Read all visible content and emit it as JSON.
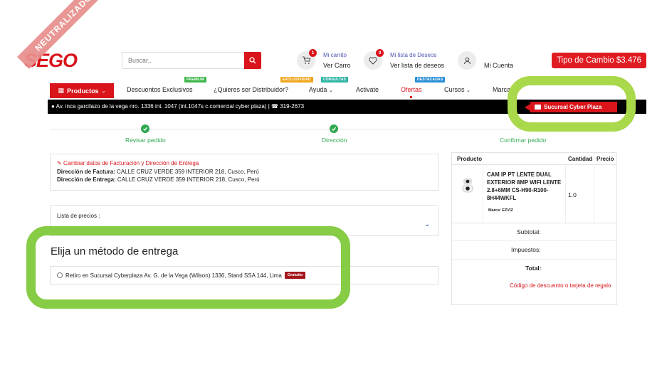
{
  "header": {
    "logo": "SEGO",
    "search_placeholder": "Buscar..",
    "cart_small": "Mi carrito",
    "cart_link": "Ver Carro",
    "cart_count": "1",
    "wishlist_small": "Mi lista de Deseos",
    "wishlist_link": "Ver lista de deseos",
    "wishlist_count": "0",
    "account": "Mi Cuenta",
    "exchange": "Tipo de Cambio $3.476"
  },
  "ribbon": "NEUTRALIZADO",
  "nav": {
    "products": "Productos",
    "items": [
      {
        "label": "Descuentos Exclusivos",
        "tag": "PREMIUM"
      },
      {
        "label": "¿Quieres ser Distribuidor?",
        "tag": "EXCLUSIVIDAD"
      },
      {
        "label": "Ayuda",
        "tag": "CONSULTAS"
      },
      {
        "label": "Activate",
        "tag": ""
      },
      {
        "label": "Ofertas",
        "tag": "DESTACADAS"
      },
      {
        "label": "Cursos",
        "tag": ""
      },
      {
        "label": "Marca",
        "tag": ""
      }
    ],
    "tag_colors": {
      "PREMIUM": "#3cb84a",
      "EXCLUSIVIDAD": "#f0a51c",
      "CONSULTAS": "#2fb5a5",
      "DESTACADAS": "#2c8fd6"
    }
  },
  "address_bar": {
    "address": "Av. inca garcilazo de la vega nro. 1336 int. 1047 (int.1047s c.comercial cyber plaza) |",
    "phone": "319-2673",
    "branch": "Sucursal Cyber Plaza"
  },
  "steps": [
    {
      "label": "Revisar pedido",
      "done": true
    },
    {
      "label": "Dirección",
      "done": true
    },
    {
      "label": "Confirmar pedido",
      "done": false
    }
  ],
  "billing": {
    "edit_link": "Cambiar datos de Facturación y Dirección de Entrega",
    "billing_label": "Dirección de Factura:",
    "billing_value": "CALLE CRUZ VERDE 359 INTERIOR 218, Cusco, Perú",
    "delivery_label": "Dirección de Entrega:",
    "delivery_value": "CALLE CRUZ VERDE 359 INTERIOR 218, Cusco, Perú"
  },
  "price_list": {
    "label": "Lista de precios :"
  },
  "delivery": {
    "heading": "Elija un método de entrega",
    "option": "Retiro en Sucursal Cyberplaza Av. G. de la Vega (Wilson) 1336, Stand SSA 144, Lima",
    "badge": "Gratuito"
  },
  "cart": {
    "headers": {
      "product": "Producto",
      "qty": "Cantidad",
      "price": "Precio"
    },
    "item": {
      "name": "CAM IP PT LENTE DUAL EXTERIOR 8MP WIFI LENTE 2.8+6MM CS-H90-R100-8H44WKFL",
      "brand": "Marca: EZVIZ",
      "qty": "1.0"
    },
    "subtotal": "Subtotal:",
    "taxes": "Impuestos:",
    "total": "Total:",
    "discount_link": "Código de descuento o tarjeta de regalo"
  }
}
